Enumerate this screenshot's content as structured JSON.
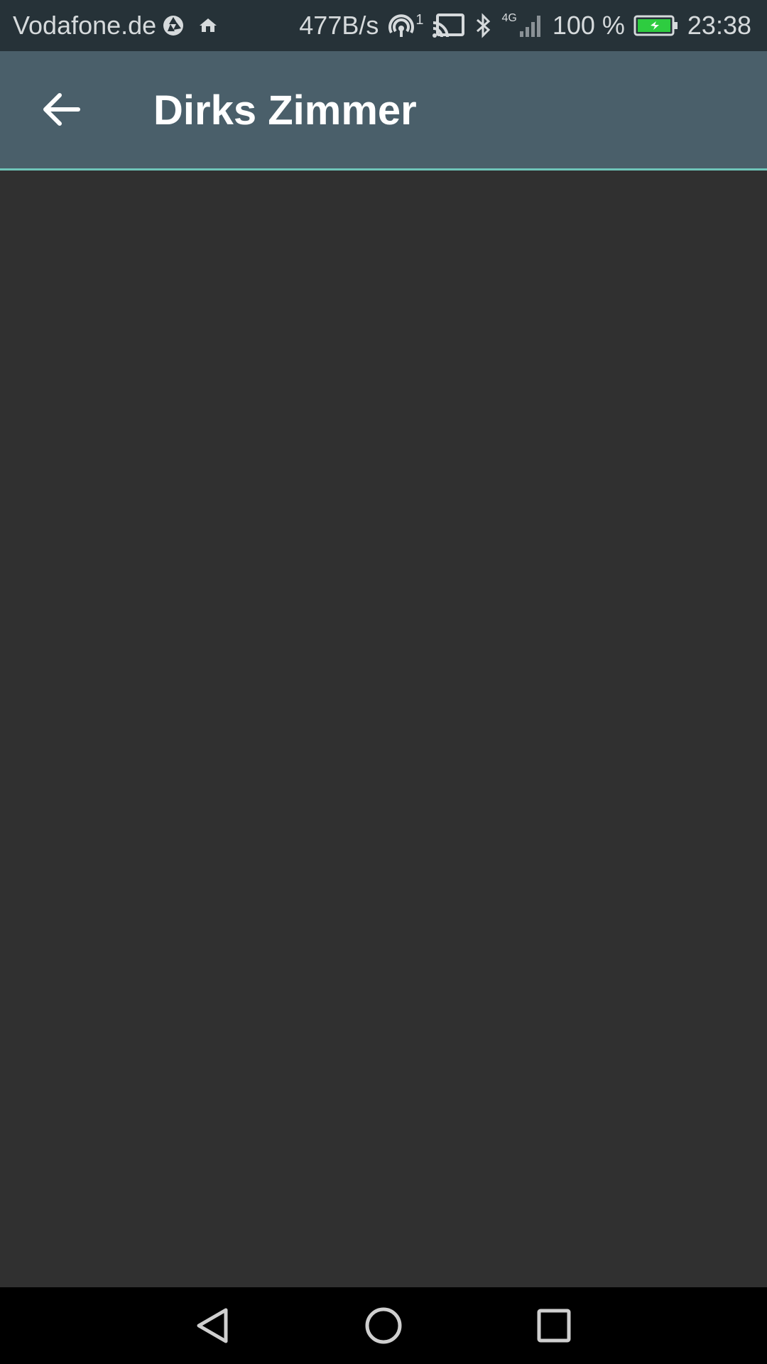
{
  "status_bar": {
    "carrier": "Vodafone.de",
    "net_speed": "477B/s",
    "hotspot_count": "1",
    "network_type": "4G",
    "battery_percent": "100 %",
    "time": "23:38",
    "battery_color": "#2ecc40"
  },
  "app_bar": {
    "title": "Dirks Zimmer",
    "accent_color": "#6fc5b9",
    "background_color": "#4a5f6a"
  },
  "nav_bar": {
    "back_icon": "triangle-back-icon",
    "home_icon": "circle-home-icon",
    "recents_icon": "square-recents-icon"
  }
}
